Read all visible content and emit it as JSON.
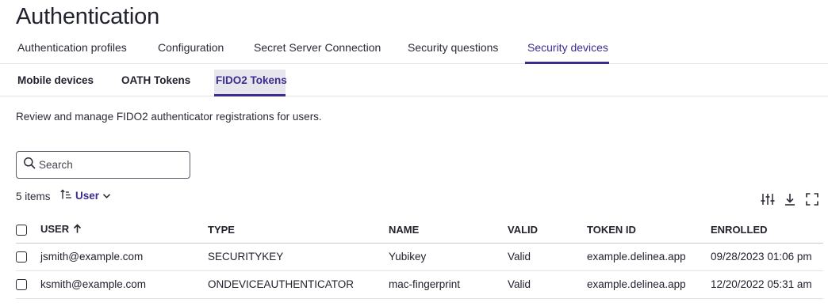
{
  "page": {
    "title": "Authentication"
  },
  "tabs": [
    {
      "label": "Authentication profiles",
      "active": false
    },
    {
      "label": "Configuration",
      "active": false
    },
    {
      "label": "Secret Server Connection",
      "active": false
    },
    {
      "label": "Security questions",
      "active": false
    },
    {
      "label": "Security devices",
      "active": true
    }
  ],
  "subtabs": [
    {
      "label": "Mobile devices",
      "active": false
    },
    {
      "label": "OATH Tokens",
      "active": false
    },
    {
      "label": "FIDO2 Tokens",
      "active": true
    }
  ],
  "description": "Review and manage FIDO2 authenticator registrations for users.",
  "search": {
    "placeholder": "Search",
    "value": ""
  },
  "list": {
    "count_label": "5 items",
    "sort_label": "User",
    "sort_direction": "ascending"
  },
  "toolbar_icons": [
    "filter-sliders-icon",
    "download-icon",
    "fullscreen-icon"
  ],
  "table": {
    "columns": [
      "USER",
      "TYPE",
      "NAME",
      "VALID",
      "TOKEN ID",
      "ENROLLED"
    ],
    "rows": [
      [
        "jsmith@example.com",
        "SECURITYKEY",
        "Yubikey",
        "Valid",
        "example.delinea.app",
        "09/28/2023 01:06 pm"
      ],
      [
        "ksmith@example.com",
        "ONDEVICEAUTHENTICATOR",
        "mac-fingerprint",
        "Valid",
        "example.delinea.app",
        "12/20/2022 05:31 am"
      ]
    ]
  },
  "colors": {
    "accent": "#3b2d8f",
    "border": "#e3e3e8",
    "text": "#22222e",
    "active_subtab_bg": "#e6e6ec"
  }
}
